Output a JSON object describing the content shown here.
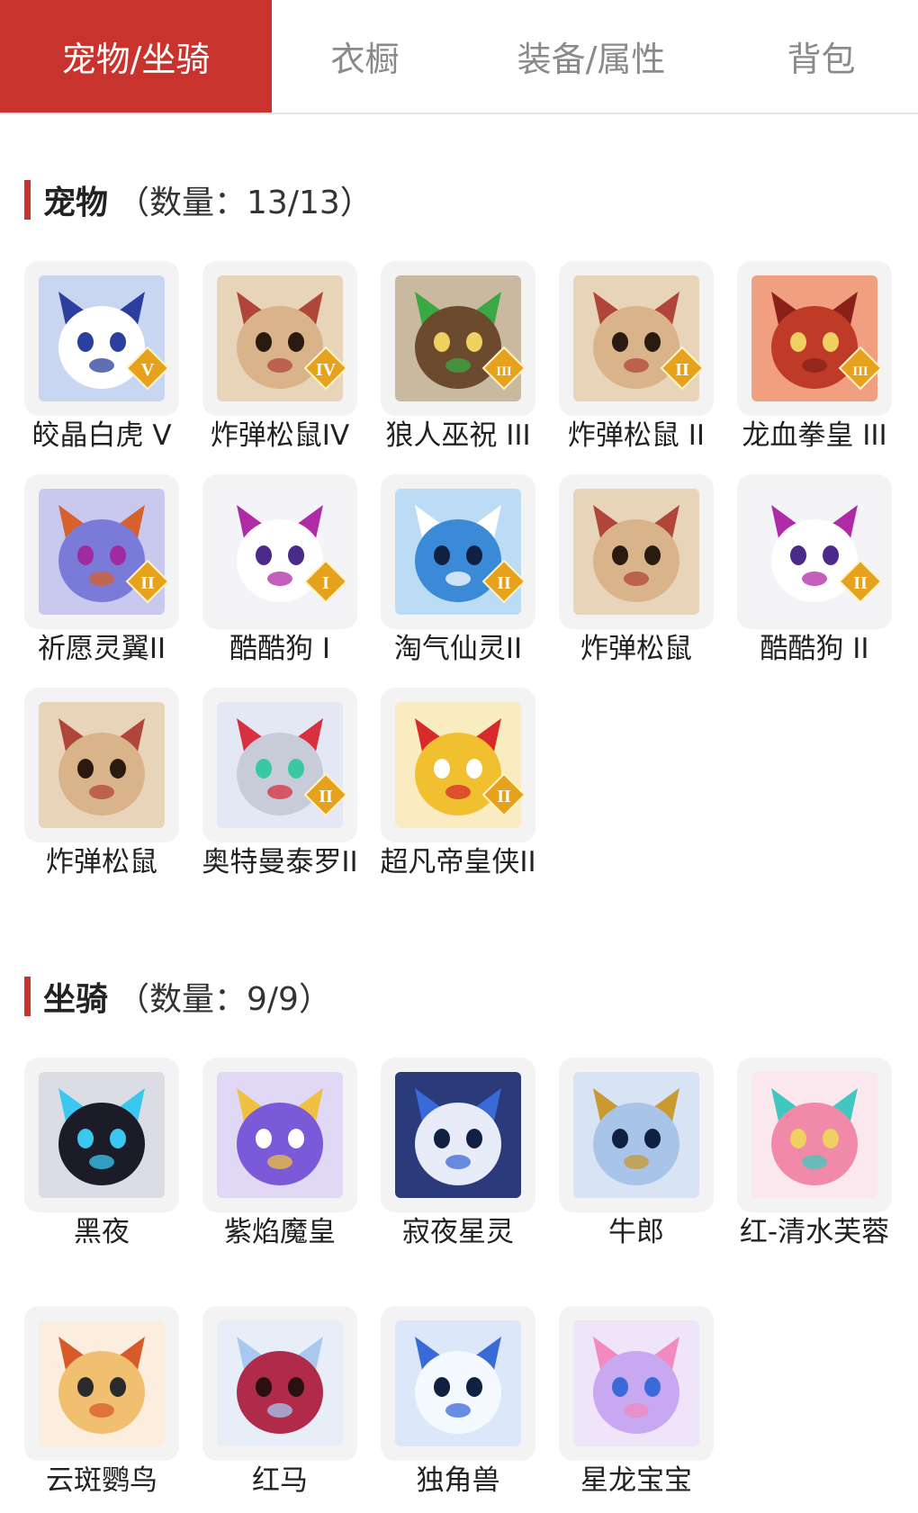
{
  "tabs": [
    {
      "label": "宠物/坐骑",
      "active": true
    },
    {
      "label": "衣橱",
      "active": false
    },
    {
      "label": "装备/属性",
      "active": false
    },
    {
      "label": "背包",
      "active": false
    }
  ],
  "pets": {
    "title": "宠物",
    "count": "（数量：13/13）",
    "items": [
      {
        "name": "皎晶白虎 V",
        "rank": "V",
        "icon": "white-tiger-icon"
      },
      {
        "name": "炸弹松鼠IV",
        "rank": "IV",
        "icon": "squirrel-icon"
      },
      {
        "name": "狼人巫祝 III",
        "rank": "III",
        "icon": "werewolf-icon"
      },
      {
        "name": "炸弹松鼠 II",
        "rank": "II",
        "icon": "squirrel-icon"
      },
      {
        "name": "龙血拳皇 III",
        "rank": "III",
        "icon": "red-dragon-icon"
      },
      {
        "name": "祈愿灵翼II",
        "rank": "II",
        "icon": "bird-icon"
      },
      {
        "name": "酷酷狗 I",
        "rank": "I",
        "icon": "goggle-dog-icon"
      },
      {
        "name": "淘气仙灵II",
        "rank": "II",
        "icon": "blue-puppy-icon"
      },
      {
        "name": "炸弹松鼠",
        "rank": "",
        "icon": "squirrel-icon"
      },
      {
        "name": "酷酷狗 II",
        "rank": "II",
        "icon": "goggle-dog-icon"
      },
      {
        "name": "炸弹松鼠",
        "rank": "",
        "icon": "squirrel-icon"
      },
      {
        "name": "奥特曼泰罗II",
        "rank": "II",
        "icon": "ultraman-icon"
      },
      {
        "name": "超凡帝皇侠II",
        "rank": "II",
        "icon": "golden-warrior-icon"
      }
    ]
  },
  "mounts": {
    "title": "坐骑",
    "count": "（数量：9/9）",
    "items": [
      {
        "name": "黑夜",
        "icon": "black-dragon-icon"
      },
      {
        "name": "紫焰魔皇",
        "icon": "purple-phoenix-icon"
      },
      {
        "name": "寂夜星灵",
        "icon": "star-wolf-icon"
      },
      {
        "name": "牛郎",
        "icon": "ox-icon"
      },
      {
        "name": "红-清水芙蓉",
        "icon": "lotus-icon"
      },
      {
        "name": "云斑鹦鸟",
        "icon": "parrot-icon"
      },
      {
        "name": "红马",
        "icon": "red-horse-icon"
      },
      {
        "name": "独角兽",
        "icon": "unicorn-icon"
      },
      {
        "name": "星龙宝宝",
        "icon": "baby-dragon-icon"
      }
    ]
  },
  "colors": {
    "accent": "#c8342d",
    "card_bg": "#f3f3f3",
    "badge": "#e6a21c"
  }
}
